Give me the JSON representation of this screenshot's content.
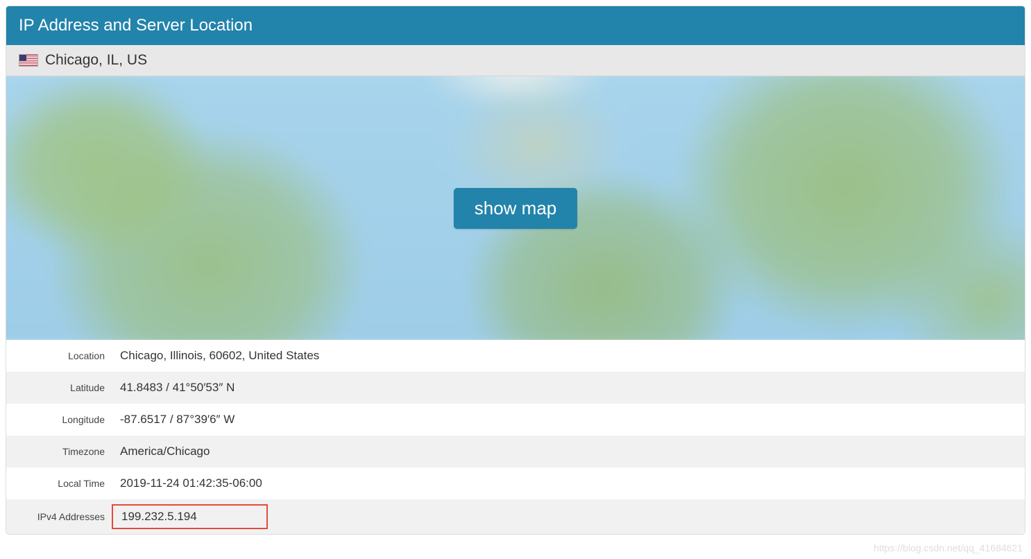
{
  "panel": {
    "title": "IP Address and Server Location"
  },
  "location_bar": {
    "flag": "us-flag-icon",
    "text": "Chicago, IL, US"
  },
  "map": {
    "button_label": "show map"
  },
  "details": {
    "rows": [
      {
        "label": "Location",
        "value": "Chicago, Illinois, 60602, United States"
      },
      {
        "label": "Latitude",
        "value": "41.8483 / 41°50′53″ N"
      },
      {
        "label": "Longitude",
        "value": "-87.6517 / 87°39′6″ W"
      },
      {
        "label": "Timezone",
        "value": "America/Chicago"
      },
      {
        "label": "Local Time",
        "value": "2019-11-24 01:42:35-06:00"
      },
      {
        "label": "IPv4 Addresses",
        "value": "199.232.5.194",
        "highlighted": true
      }
    ]
  },
  "watermark": "https://blog.csdn.net/qq_41684621"
}
